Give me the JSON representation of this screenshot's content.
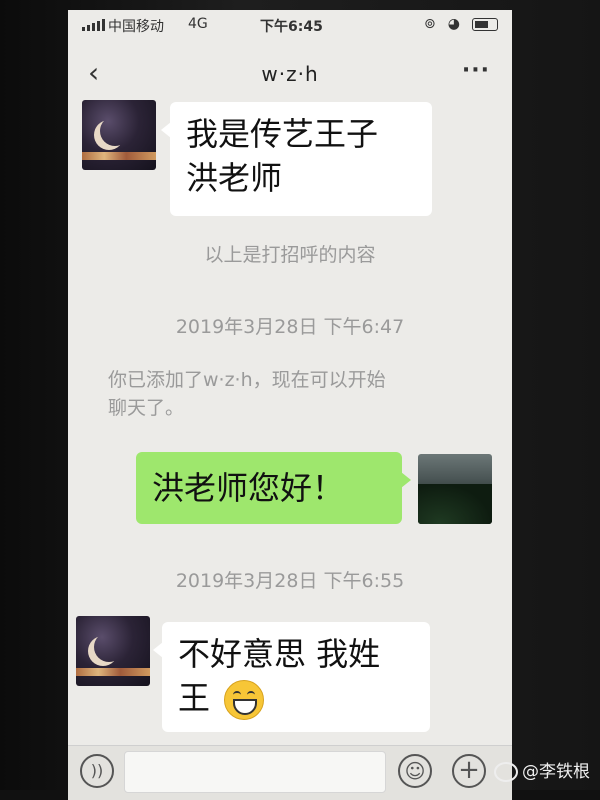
{
  "status_bar": {
    "carrier": "中国移动",
    "network": "4G",
    "time": "下午6:45"
  },
  "nav": {
    "title": "w·z·h",
    "back_icon": "chevron-left-icon",
    "more_icon": "more-dots-icon",
    "more_glyph": "···"
  },
  "messages": [
    {
      "side": "left",
      "text_line1": "我是传艺王子",
      "text_line2": "洪老师"
    },
    {
      "side": "system",
      "text": "以上是打招呼的内容"
    },
    {
      "side": "timestamp",
      "text": "2019年3月28日 下午6:47"
    },
    {
      "side": "system",
      "text_line1": "你已添加了w·z·h，现在可以开始",
      "text_line2": "聊天了。"
    },
    {
      "side": "right",
      "text": "洪老师您好！"
    },
    {
      "side": "timestamp",
      "text": "2019年3月28日 下午6:55"
    },
    {
      "side": "left",
      "text_line1": "不好意思 我姓",
      "text_line2": "王",
      "emoji": "grin-emoji"
    }
  ],
  "input_bar": {
    "voice_icon": "voice-icon",
    "emoji_icon": "smiley-icon",
    "plus_icon": "plus-icon",
    "plus_glyph": "+"
  },
  "watermark": {
    "text": "@李铁根"
  },
  "colors": {
    "chat_bg": "#ecebe8",
    "self_bubble": "#9ee76d",
    "other_bubble": "#ffffff"
  }
}
